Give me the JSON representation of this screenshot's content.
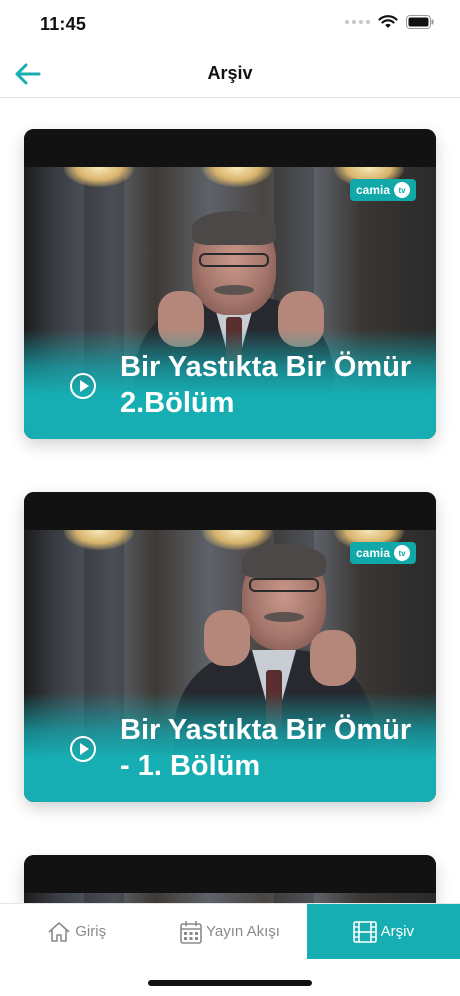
{
  "status_bar": {
    "time": "11:45"
  },
  "nav": {
    "title": "Arşiv"
  },
  "cards": [
    {
      "title": "Bir Yastıkta Bir Ömür 2.Bölüm",
      "logo_text": "camia",
      "logo_badge": "tv"
    },
    {
      "title": "Bir Yastıkta Bir Ömür - 1. Bölüm",
      "logo_text": "camia",
      "logo_badge": "tv"
    }
  ],
  "tabs": [
    {
      "label": "Giriş",
      "icon": "home-icon",
      "active": false
    },
    {
      "label": "Yayın Akışı",
      "icon": "calendar-icon",
      "active": false
    },
    {
      "label": "Arşiv",
      "icon": "film-icon",
      "active": true
    }
  ],
  "colors": {
    "accent": "#16aeb2"
  }
}
